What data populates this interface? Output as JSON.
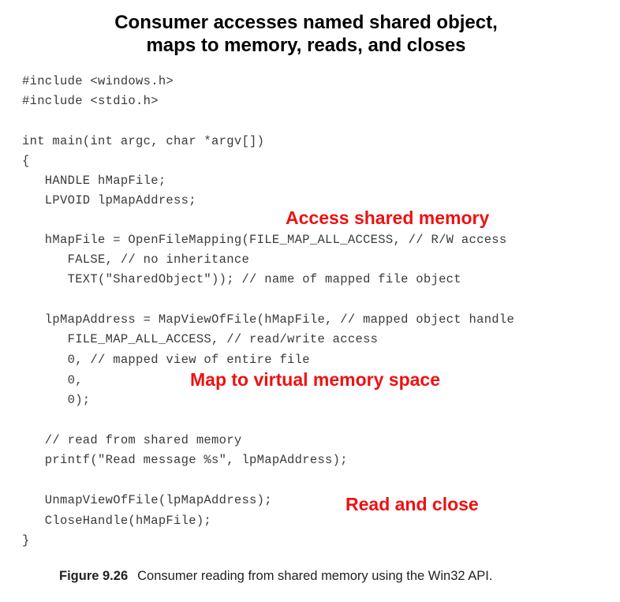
{
  "slide": {
    "title_line1": "Consumer accesses named shared object,",
    "title_line2": "maps to memory, reads, and closes",
    "accent_color": "#ee1111"
  },
  "code_lines": [
    "#include <windows.h>",
    "#include <stdio.h>",
    "int main(int argc, char *argv[])",
    "{",
    "   HANDLE hMapFile;",
    "   LPVOID lpMapAddress;",
    "   hMapFile = OpenFileMapping(FILE_MAP_ALL_ACCESS, // R/W access",
    "      FALSE, // no inheritance",
    "      TEXT(\"SharedObject\")); // name of mapped file object",
    "   lpMapAddress = MapViewOfFile(hMapFile, // mapped object handle",
    "      FILE_MAP_ALL_ACCESS, // read/write access",
    "      0, // mapped view of entire file",
    "      0,",
    "      0);",
    "   // read from shared memory",
    "   printf(\"Read message %s\", lpMapAddress);",
    "   UnmapViewOfFile(lpMapAddress);",
    "   CloseHandle(hMapFile);",
    "}"
  ],
  "annotations": {
    "access": "Access shared memory",
    "map": "Map to virtual memory space",
    "read_close": "Read and close"
  },
  "caption": {
    "figure_label": "Figure 9.26",
    "text": "Consumer reading from shared memory using the Win32 API."
  }
}
